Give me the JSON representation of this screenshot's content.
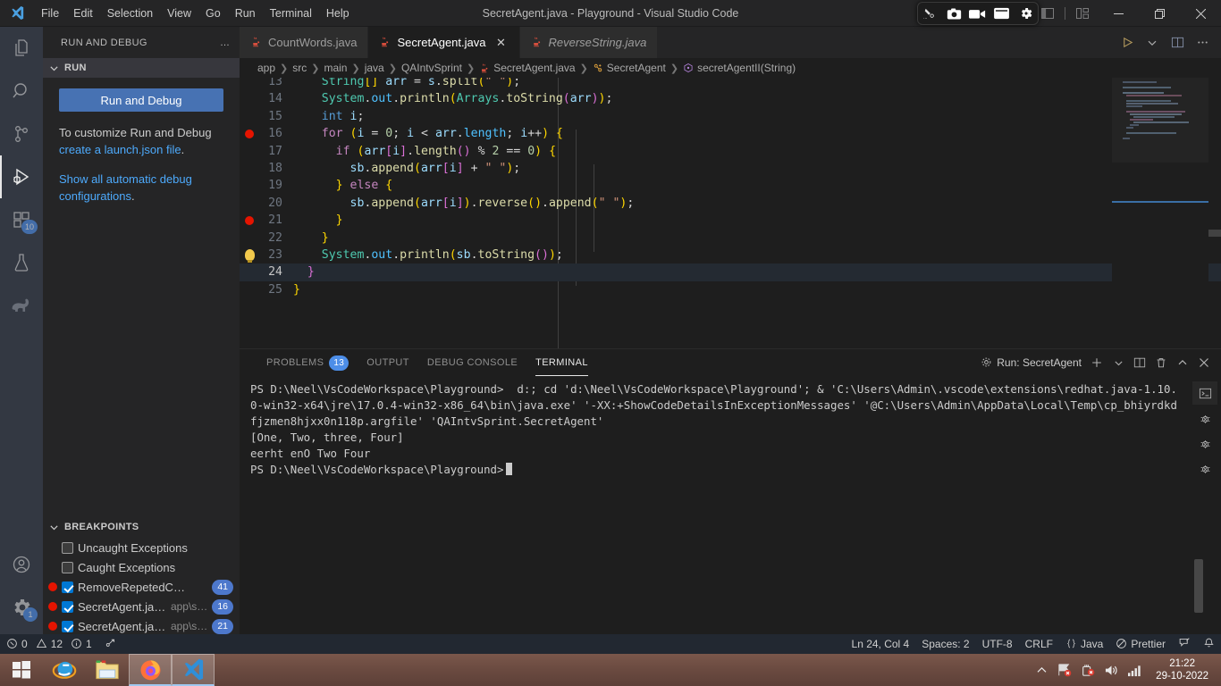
{
  "window": {
    "title": "SecretAgent.java - Playground - Visual Studio Code",
    "menu": [
      "File",
      "Edit",
      "Selection",
      "View",
      "Go",
      "Run",
      "Terminal",
      "Help"
    ]
  },
  "capture_toolbar": {
    "items": [
      "snip-icon",
      "camera-icon",
      "video-icon",
      "window-icon",
      "gear-icon"
    ]
  },
  "activitybar": {
    "items": [
      {
        "name": "explorer",
        "icon": "files-icon",
        "badge": ""
      },
      {
        "name": "search",
        "icon": "search-icon",
        "badge": ""
      },
      {
        "name": "source-control",
        "icon": "source-control-icon",
        "badge": ""
      },
      {
        "name": "run-and-debug",
        "icon": "run-debug-icon",
        "badge": ""
      },
      {
        "name": "extensions",
        "icon": "extensions-icon",
        "badge": "10"
      },
      {
        "name": "testing",
        "icon": "beaker-icon",
        "badge": ""
      },
      {
        "name": "sonarlint",
        "icon": "elephant-icon",
        "badge": ""
      }
    ],
    "bottom": [
      {
        "name": "accounts",
        "icon": "account-icon",
        "badge": ""
      },
      {
        "name": "manage",
        "icon": "gear-icon",
        "badge": "1"
      }
    ]
  },
  "sidebar": {
    "title": "RUN AND DEBUG",
    "more_label": "…",
    "run_section": {
      "header": "RUN",
      "button_label": "Run and Debug",
      "text_line1": "To customize Run and Debug",
      "link1": "create a launch.json file",
      "text_after_link1": ".",
      "link2": "Show all automatic debug configurations",
      "text_after_link2": "."
    },
    "breakpoints_section": {
      "header": "BREAKPOINTS",
      "items": [
        {
          "dot": false,
          "checked": false,
          "name": "Uncaught Exceptions",
          "path": "",
          "line": ""
        },
        {
          "dot": false,
          "checked": false,
          "name": "Caught Exceptions",
          "path": "",
          "line": ""
        },
        {
          "dot": true,
          "checked": true,
          "name": "RemoveRepetedChar.j…",
          "path": "",
          "line": "41"
        },
        {
          "dot": true,
          "checked": true,
          "name": "SecretAgent.java",
          "path": "app\\s…",
          "line": "16"
        },
        {
          "dot": true,
          "checked": true,
          "name": "SecretAgent.java",
          "path": "app\\s…",
          "line": "21"
        }
      ]
    }
  },
  "tabs": [
    {
      "label": "CountWords.java",
      "active": false,
      "italic": false,
      "icon": "java-icon"
    },
    {
      "label": "SecretAgent.java",
      "active": true,
      "italic": false,
      "icon": "java-icon",
      "close": "✕"
    },
    {
      "label": "ReverseString.java",
      "active": false,
      "italic": true,
      "icon": "java-icon"
    }
  ],
  "editor_actions": [
    "run-icon",
    "chevron-down-icon",
    "split-editor-icon",
    "more-actions-icon"
  ],
  "breadcrumb": [
    {
      "label": "app",
      "icon": ""
    },
    {
      "label": "src",
      "icon": ""
    },
    {
      "label": "main",
      "icon": ""
    },
    {
      "label": "java",
      "icon": ""
    },
    {
      "label": "QAIntvSprint",
      "icon": ""
    },
    {
      "label": "SecretAgent.java",
      "icon": "java-icon"
    },
    {
      "label": "SecretAgent",
      "icon": "class-icon"
    },
    {
      "label": "secretAgentII(String)",
      "icon": "method-icon"
    }
  ],
  "code": {
    "lines": [
      {
        "num": "13",
        "bp": false,
        "bulb": false,
        "current": false,
        "text": "    String[] arr = s.split(\" \");"
      },
      {
        "num": "14",
        "bp": false,
        "bulb": false,
        "current": false,
        "text": "    System.out.println(Arrays.toString(arr));"
      },
      {
        "num": "15",
        "bp": false,
        "bulb": false,
        "current": false,
        "text": "    int i;"
      },
      {
        "num": "16",
        "bp": true,
        "bulb": false,
        "current": false,
        "text": "    for (i = 0; i < arr.length; i++) {"
      },
      {
        "num": "17",
        "bp": false,
        "bulb": false,
        "current": false,
        "text": "      if (arr[i].length() % 2 == 0) {"
      },
      {
        "num": "18",
        "bp": false,
        "bulb": false,
        "current": false,
        "text": "        sb.append(arr[i] + \" \");"
      },
      {
        "num": "19",
        "bp": false,
        "bulb": false,
        "current": false,
        "text": "      } else {"
      },
      {
        "num": "20",
        "bp": false,
        "bulb": false,
        "current": false,
        "text": "        sb.append(arr[i]).reverse().append(\" \");"
      },
      {
        "num": "21",
        "bp": true,
        "bulb": false,
        "current": false,
        "text": "      }"
      },
      {
        "num": "22",
        "bp": false,
        "bulb": false,
        "current": false,
        "text": "    }"
      },
      {
        "num": "23",
        "bp": false,
        "bulb": true,
        "current": false,
        "text": "    System.out.println(sb.toString());"
      },
      {
        "num": "24",
        "bp": false,
        "bulb": false,
        "current": true,
        "text": "  }"
      },
      {
        "num": "25",
        "bp": false,
        "bulb": false,
        "current": false,
        "text": "}"
      }
    ]
  },
  "panel": {
    "tabs": [
      {
        "label": "PROBLEMS",
        "badge": "13",
        "active": false
      },
      {
        "label": "OUTPUT",
        "badge": "",
        "active": false
      },
      {
        "label": "DEBUG CONSOLE",
        "badge": "",
        "active": false
      },
      {
        "label": "TERMINAL",
        "badge": "",
        "active": true
      }
    ],
    "terminal_selector": "Run: SecretAgent",
    "actions": [
      "new-terminal-icon",
      "chevron-down-icon",
      "split-terminal-icon",
      "kill-terminal-icon",
      "maximize-panel-icon",
      "close-panel-icon"
    ],
    "side_icons": [
      "terminal-tab-icon",
      "debug-tab-icon",
      "debug-tab-icon",
      "debug-tab-icon"
    ],
    "terminal_lines": [
      "PS D:\\Neel\\VsCodeWorkspace\\Playground>  d:; cd 'd:\\Neel\\VsCodeWorkspace\\Playground'; & 'C:\\Users\\Admin\\.vscode\\extensions\\redhat.java-1.10.0-win32-x64\\jre\\17.0.4-win32-x86_64\\bin\\java.exe' '-XX:+ShowCodeDetailsInExceptionMessages' '@C:\\Users\\Admin\\AppData\\Local\\Temp\\cp_bhiyrdkdfjzmen8hjxx0n118p.argfile' 'QAIntvSprint.SecretAgent'",
      "[One, Two, three, Four]",
      "eerht enO Two Four"
    ],
    "prompt": "PS D:\\Neel\\VsCodeWorkspace\\Playground>"
  },
  "statusbar": {
    "left": [
      {
        "icon": "error-icon",
        "label": "0"
      },
      {
        "icon": "warning-icon",
        "label": "12"
      },
      {
        "icon": "info-icon",
        "label": "1"
      },
      {
        "icon": "ports-icon",
        "label": ""
      }
    ],
    "right": [
      {
        "icon": "",
        "label": "Ln 24, Col 4"
      },
      {
        "icon": "",
        "label": "Spaces: 2"
      },
      {
        "icon": "",
        "label": "UTF-8"
      },
      {
        "icon": "",
        "label": "CRLF"
      },
      {
        "icon": "braces-icon",
        "label": "Java"
      },
      {
        "icon": "prettier-icon",
        "label": "Prettier"
      },
      {
        "icon": "feedback-icon",
        "label": ""
      },
      {
        "icon": "bell-icon",
        "label": ""
      }
    ]
  },
  "taskbar": {
    "apps": [
      {
        "name": "start",
        "icon": "windows-icon",
        "open": false
      },
      {
        "name": "internet-explorer",
        "icon": "ie-icon",
        "open": false
      },
      {
        "name": "file-explorer",
        "icon": "folder-icon",
        "open": false
      },
      {
        "name": "firefox",
        "icon": "firefox-icon",
        "open": true
      },
      {
        "name": "visual-studio-code",
        "icon": "vscode-icon",
        "open": true
      }
    ],
    "tray": [
      "show-hidden-icon",
      "network-error-icon",
      "battery-error-icon",
      "volume-icon",
      "signal-icon"
    ],
    "clock_time": "21:22",
    "clock_date": "29-10-2022"
  },
  "colors": {
    "accent": "#4d8ee8",
    "breakpoint": "#e51400",
    "button": "#4772b3",
    "statusbar_bg": "#222831"
  }
}
